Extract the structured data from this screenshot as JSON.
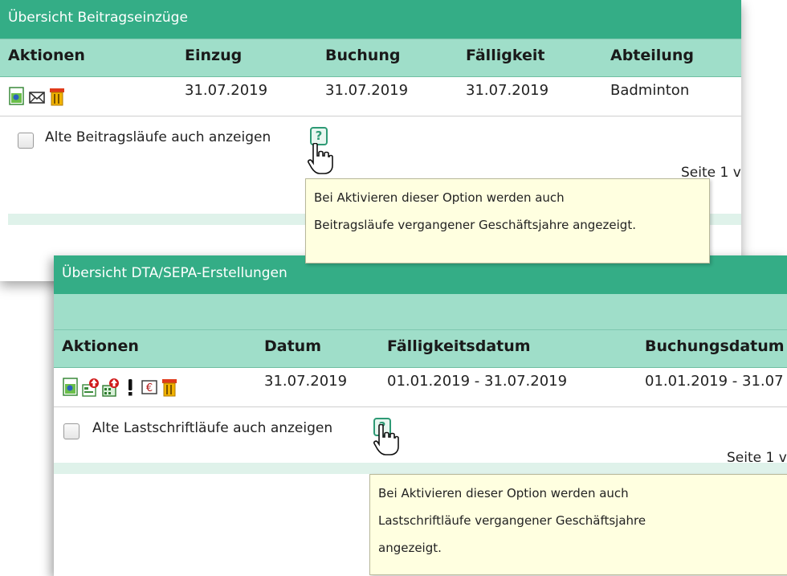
{
  "panel1": {
    "title": "Übersicht Beitragseinzüge",
    "columns": [
      "Aktionen",
      "Einzug",
      "Buchung",
      "Fälligkeit",
      "Abteilung"
    ],
    "row": {
      "einzug": "31.07.2019",
      "buchung": "31.07.2019",
      "faelligkeit": "31.07.2019",
      "abteilung": "Badminton"
    },
    "icons": [
      "view-icon",
      "envelope-icon",
      "trash-icon"
    ],
    "checkbox_label": "Alte Beitragsläufe auch anzeigen",
    "help_glyph": "?",
    "seite": "Seite 1 v",
    "tooltip_lines": [
      "Bei Aktivieren dieser Option werden auch",
      "Beitragsläufe vergangener Geschäftsjahre angezeigt."
    ]
  },
  "panel2": {
    "title": "Übersicht DTA/SEPA-Erstellungen",
    "columns": [
      "Aktionen",
      "Datum",
      "Fälligkeitsdatum",
      "Buchungsdatum"
    ],
    "row": {
      "datum": "31.07.2019",
      "faelligkeitsdatum": "01.01.2019 - 31.07.2019",
      "buchungsdatum": "01.01.2019 - 31.07"
    },
    "icons": [
      "view-icon",
      "export-icon",
      "upload-icon",
      "exclamation-icon",
      "euro-icon",
      "trash-icon"
    ],
    "checkbox_label": "Alte Lastschriftläufe auch anzeigen",
    "help_glyph": "?",
    "seite": "Seite 1 v",
    "tooltip_lines": [
      "Bei Aktivieren dieser Option werden auch",
      "Lastschriftläufe vergangener Geschäftsjahre",
      "angezeigt."
    ]
  },
  "colors": {
    "title_bar": "#34ad86",
    "header_bar": "#9fdec9",
    "tooltip_bg": "#ffffe0"
  }
}
